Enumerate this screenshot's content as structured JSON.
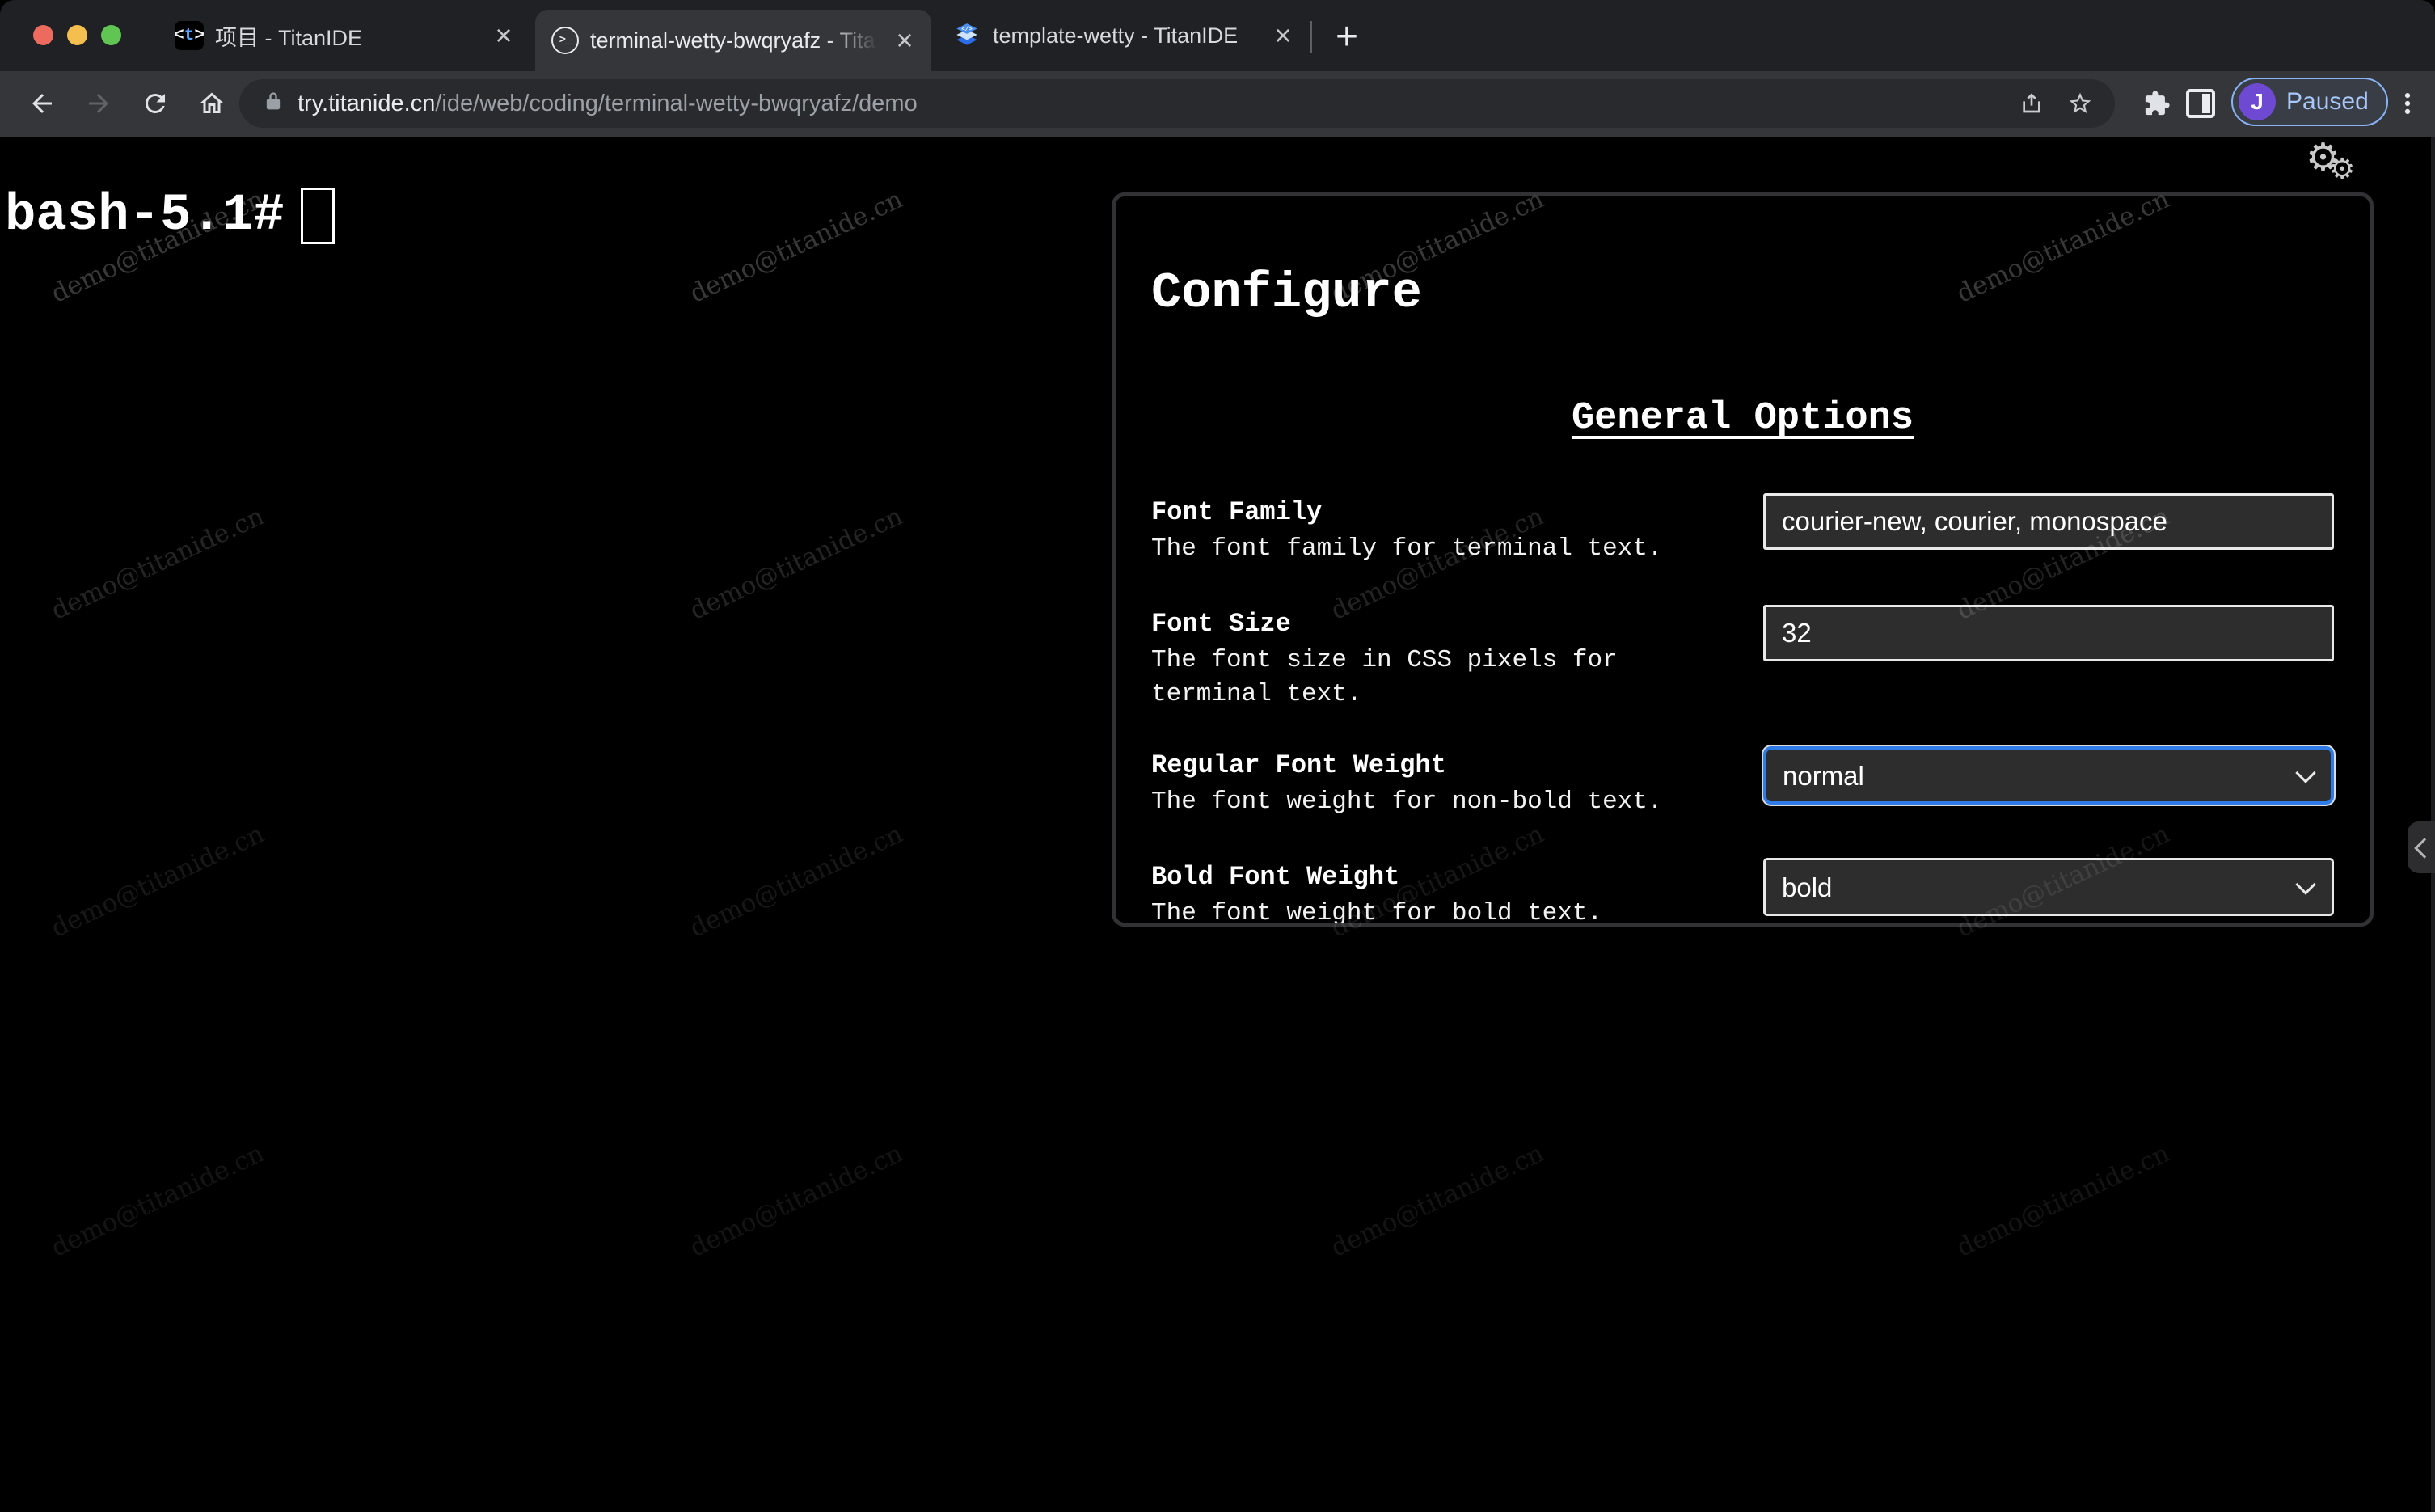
{
  "tabs": [
    {
      "title": "项目 - TitanIDE"
    },
    {
      "title": "terminal-wetty-bwqryafz - Tita"
    },
    {
      "title": "template-wetty - TitanIDE"
    }
  ],
  "toolbar": {
    "url_host": "try.titanide.cn",
    "url_path": "/ide/web/coding/terminal-wetty-bwqryafz/demo",
    "profile_initial": "J",
    "profile_status": "Paused"
  },
  "icons": {
    "new_tab": "+",
    "close_tab": "×",
    "gear": "⚙",
    "titanide_open": "<",
    "titanide_letter": "t",
    "titanide_close": ">",
    "terminal_glyph": ">_",
    "template_code": "</>"
  },
  "terminal": {
    "prompt": "bash-5.1#"
  },
  "watermark": {
    "text": "demo@titanide.cn"
  },
  "configure_panel": {
    "title": "Configure",
    "section_heading": "General Options",
    "fields": [
      {
        "label": "Font Family",
        "description": "The font family for terminal text.",
        "control": "input",
        "value": "courier-new, courier, monospace"
      },
      {
        "label": "Font Size",
        "description": "The font size in CSS pixels for terminal text.",
        "control": "input",
        "value": "32"
      },
      {
        "label": "Regular Font Weight",
        "description": "The font weight for non-bold text.",
        "control": "select",
        "value": "normal"
      },
      {
        "label": "Bold Font Weight",
        "description": "The font weight for bold text.",
        "control": "select",
        "value": "bold"
      }
    ]
  },
  "colors": {
    "focus_accent": "#2f7ce8",
    "paused_blue": "#a8c7fa",
    "avatar_purple": "#6e4ad2",
    "traffic_red": "#ed6a5e",
    "traffic_yellow": "#f5bf4f",
    "traffic_green": "#61c554",
    "panel_border": "#323234"
  }
}
